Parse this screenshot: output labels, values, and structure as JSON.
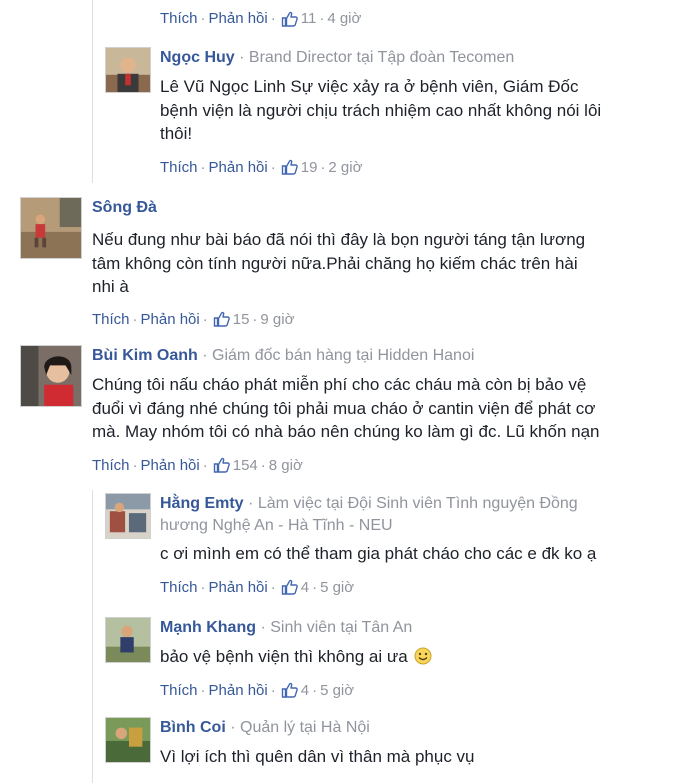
{
  "actions": {
    "like": "Thích",
    "reply": "Phản hồi",
    "sep": "·"
  },
  "first_actions": {
    "likes": "11",
    "time": "4 giờ"
  },
  "comments": [
    {
      "name": "Ngọc Huy",
      "meta": "Brand Director tại Tập đoàn Tecomen",
      "lines": [
        "Lê Vũ Ngọc Linh Sự việc xảy ra ở bệnh viên, Giám Đốc",
        "bệnh viện là người chịu trách nhiệm cao nhất không nói lôi",
        "thôi!"
      ],
      "likes": "19",
      "time": "2 giờ"
    },
    {
      "name": "Sông Đà",
      "meta": "",
      "lines": [
        "Nếu đung như bài báo đã nói thì đây là bọn người táng tận lương",
        "tâm không còn tính người nữa.Phải chăng họ kiếm chác trên hài",
        "nhi à"
      ],
      "likes": "15",
      "time": "9 giờ"
    },
    {
      "name": "Bùi Kim Oanh",
      "meta": "Giám đốc bán hàng tại Hidden Hanoi",
      "lines": [
        "Chúng tôi nấu cháo phát miễn phí cho các cháu mà còn bị bảo vệ",
        "đuổi vì đáng nhé chúng tôi phải mua cháo ở cantin viện để phát cơ",
        "mà. May nhóm tôi có nhà báo nên chúng ko làm gì đc. Lũ khốn nạn"
      ],
      "likes": "154",
      "time": "8 giờ"
    },
    {
      "name": "Hằng Emty",
      "meta": "Làm việc tại Đội Sinh viên Tình nguyện Đồng",
      "meta2": "hương Nghệ An - Hà Tĩnh - NEU",
      "lines": [
        "c ơi mình em có thể tham gia phát cháo cho các e đk ko ạ"
      ],
      "likes": "4",
      "time": "5 giờ"
    },
    {
      "name": "Mạnh Khang",
      "meta": "Sinh viên tại Tân An",
      "lines": [
        "bảo vệ bệnh viện thì không ai ưa"
      ],
      "likes": "4",
      "time": "5 giờ"
    },
    {
      "name": "Bình Coi",
      "meta": "Quản lý tại Hà Nội",
      "lines": [
        "Vì lợi ích thì quên dân vì thân mà phục vụ"
      ]
    }
  ]
}
